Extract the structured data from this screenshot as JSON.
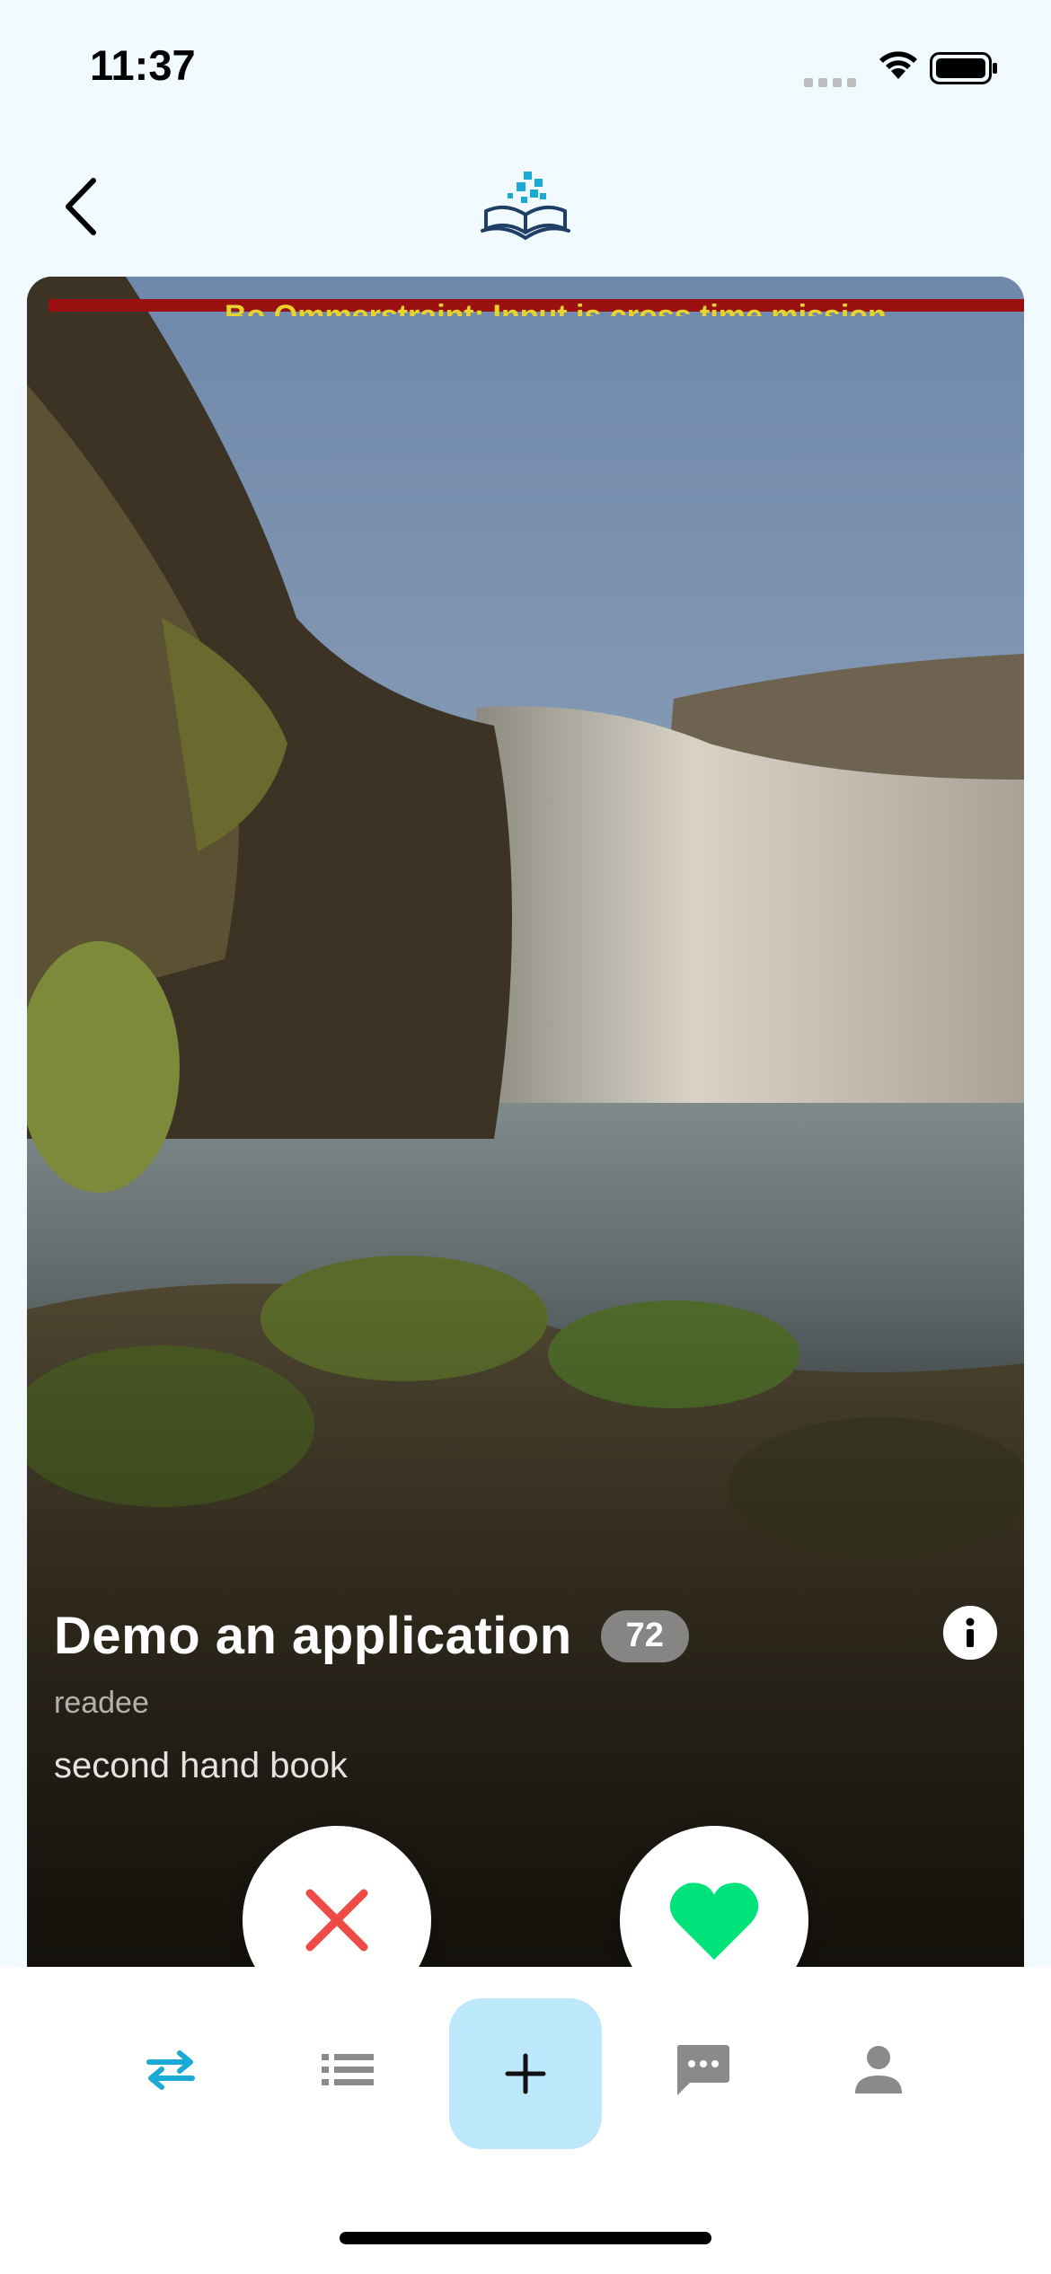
{
  "status_bar": {
    "time": "11:37"
  },
  "card": {
    "overflow_warning": "Bo Ommerstraint; Input is cross time mission",
    "title": "Demo an application",
    "score": "72",
    "owner": "readee",
    "category": "second hand book"
  },
  "colors": {
    "background": "#F1FAFE",
    "accent": "#1BA9D6",
    "like": "#00E27A",
    "dislike": "#EE4B47",
    "add_button_bg": "#BDE7FA",
    "tab_inactive": "#8A8A8A"
  },
  "icons": {
    "back": "chevron-left-icon",
    "logo": "book-logo-icon",
    "info": "info-icon",
    "dislike": "close-icon",
    "like": "heart-icon",
    "tabs": [
      "swap-arrows-icon",
      "list-icon",
      "plus-icon",
      "chat-icon",
      "person-icon"
    ]
  }
}
